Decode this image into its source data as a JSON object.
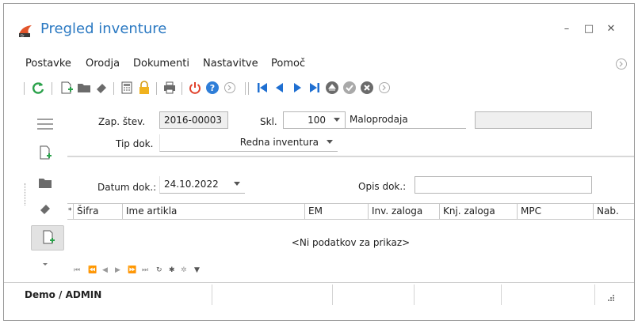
{
  "window": {
    "title": "Pregled inventure",
    "minimize_glyph": "–",
    "maximize_glyph": "□",
    "close_glyph": "✕"
  },
  "menu": {
    "items": [
      "Postavke",
      "Orodja",
      "Dokumenti",
      "Nastavitve",
      "Pomoč"
    ]
  },
  "toolbar": {
    "icons": [
      "refresh-icon",
      "new-document-icon",
      "folder-icon",
      "eraser-icon",
      "calculator-icon",
      "lock-icon",
      "print-icon",
      "power-icon",
      "help-icon",
      "forward-circle-icon",
      "first-record-icon",
      "previous-record-icon",
      "next-record-icon",
      "last-record-icon",
      "eject-icon",
      "confirm-icon",
      "cancel-icon",
      "forward-circle-small-icon"
    ]
  },
  "form": {
    "zap_stev_label": "Zap. štev.",
    "zap_stev_value": "2016-00003",
    "skl_label": "Skl.",
    "skl_value": "100",
    "skl_name": "Maloprodaja",
    "tip_dok_label": "Tip dok.",
    "tip_dok_value": "Redna inventura",
    "datum_dok_label": "Datum dok.:",
    "datum_dok_value": "24.10.2022",
    "opis_dok_label": "Opis dok.:",
    "opis_dok_value": ""
  },
  "grid": {
    "columns": [
      "Šifra",
      "Ime artikla",
      "EM",
      "Inv. zaloga",
      "Knj. zaloga",
      "MPC",
      "Nab."
    ],
    "row_marker": "*",
    "empty_text": "<Ni podatkov za prikaz>"
  },
  "status": {
    "user": "Demo / ADMIN"
  },
  "colors": {
    "title": "#2b79c2",
    "refresh": "#2aa14a",
    "nav_blue": "#1f6fd1",
    "power_red": "#e0402a",
    "help_blue": "#2f7ed8",
    "lock_yellow": "#f0b21f"
  }
}
